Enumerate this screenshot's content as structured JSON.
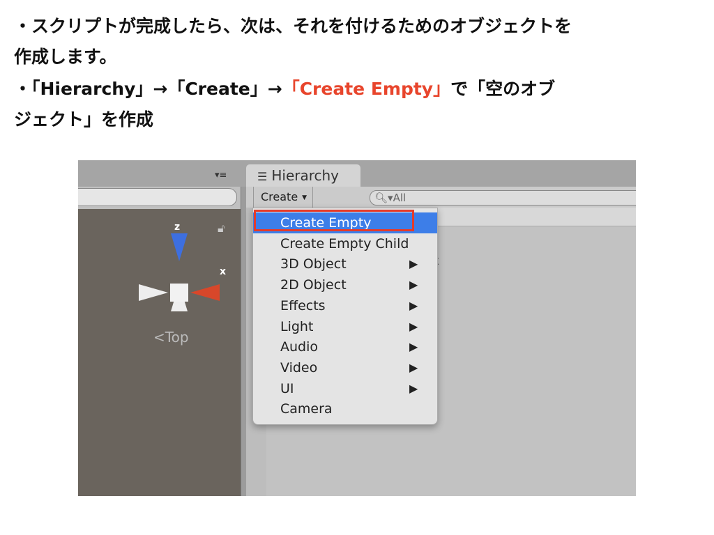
{
  "slide": {
    "line1": "・スクリプトが完成したら、次は、それを付けるためのオブジェクトを",
    "line2": "作成します。",
    "line3_a": "・「Hierarchy」→「Create」→",
    "line3_red": "「Create Empty」",
    "line3_b": "で「空のオブ",
    "line4": "ジェクト」を作成",
    "accent_color": "#e8452c"
  },
  "scene": {
    "axis_z": "z",
    "axis_x": "x",
    "view_label": "Top",
    "menu_icon": "dropdown-list-icon",
    "lock_icon": "lock-icon"
  },
  "hierarchy": {
    "tab_label": "Hierarchy",
    "create_label": "Create",
    "search_placeholder": "All",
    "hidden_item_tail": "t"
  },
  "menu": {
    "items": [
      {
        "label": "Create Empty",
        "selected": true
      },
      {
        "label": "Create Empty Child"
      },
      {
        "label": "3D Object",
        "submenu": true
      },
      {
        "label": "2D Object",
        "submenu": true
      },
      {
        "label": "Effects",
        "submenu": true
      },
      {
        "label": "Light",
        "submenu": true
      },
      {
        "label": "Audio",
        "submenu": true
      },
      {
        "label": "Video",
        "submenu": true
      },
      {
        "label": "UI",
        "submenu": true
      },
      {
        "label": "Camera"
      }
    ]
  }
}
